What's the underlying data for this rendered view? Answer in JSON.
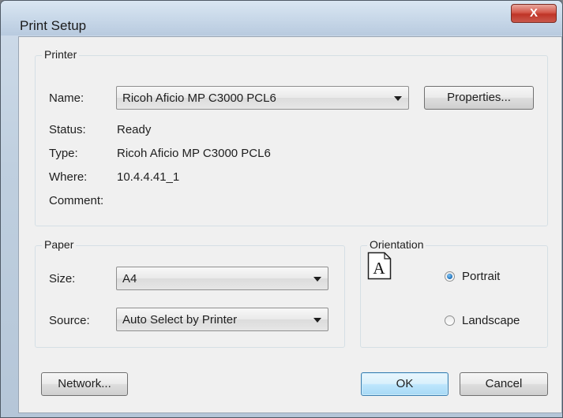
{
  "window": {
    "title": "Print Setup",
    "close_label": "X"
  },
  "printer": {
    "group_label": "Printer",
    "name_label": "Name:",
    "name_value": "Ricoh Aficio MP C3000 PCL6",
    "properties_label": "Properties...",
    "status_label": "Status:",
    "status_value": "Ready",
    "type_label": "Type:",
    "type_value": "Ricoh Aficio MP C3000 PCL6",
    "where_label": "Where:",
    "where_value": "10.4.4.41_1",
    "comment_label": "Comment:",
    "comment_value": ""
  },
  "paper": {
    "group_label": "Paper",
    "size_label": "Size:",
    "size_value": "A4",
    "source_label": "Source:",
    "source_value": "Auto Select by Printer"
  },
  "orientation": {
    "group_label": "Orientation",
    "icon_letter": "A",
    "portrait_label": "Portrait",
    "landscape_label": "Landscape",
    "selected": "Portrait"
  },
  "buttons": {
    "network_label": "Network...",
    "ok_label": "OK",
    "cancel_label": "Cancel"
  },
  "colors": {
    "close_button": "#c9584c",
    "default_button_border": "#3c7fb1",
    "radio_selected": "#1d6fb8"
  }
}
